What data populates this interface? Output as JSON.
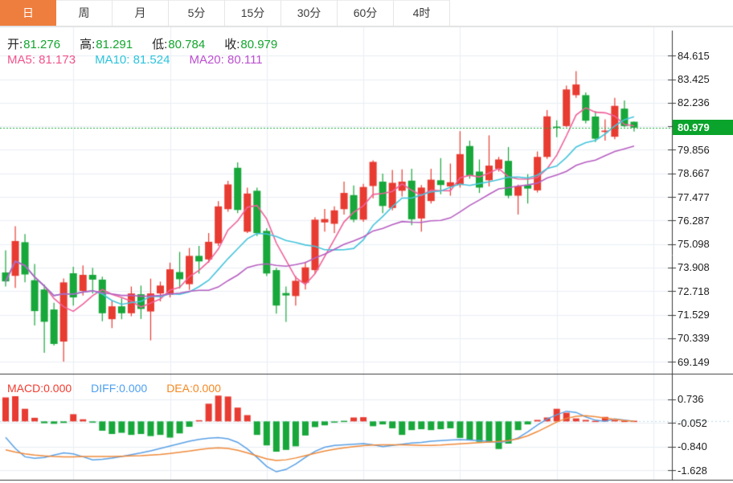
{
  "tabbar": {
    "tabs": [
      {
        "label": "日",
        "name": "tab-day",
        "active": true
      },
      {
        "label": "周",
        "name": "tab-week",
        "active": false
      },
      {
        "label": "月",
        "name": "tab-month",
        "active": false
      },
      {
        "label": "5分",
        "name": "tab-5min",
        "active": false
      },
      {
        "label": "15分",
        "name": "tab-15min",
        "active": false
      },
      {
        "label": "30分",
        "name": "tab-30min",
        "active": false
      },
      {
        "label": "60分",
        "name": "tab-60min",
        "active": false
      },
      {
        "label": "4时",
        "name": "tab-4hour",
        "active": false
      }
    ]
  },
  "legend": {
    "ohlc": [
      {
        "label": "开:",
        "value": "81.276"
      },
      {
        "label": "高:",
        "value": "81.291"
      },
      {
        "label": "低:",
        "value": "80.784"
      },
      {
        "label": "收:",
        "value": "80.979"
      }
    ],
    "ohlc_label_color": "#222222",
    "ohlc_value_color": "#13a52e",
    "ma": [
      {
        "label": "MA5: 81.173",
        "color": "#f0548c"
      },
      {
        "label": "MA10: 81.524",
        "color": "#2cc3dc"
      },
      {
        "label": "MA20: 80.111",
        "color": "#bb4fd0"
      }
    ],
    "macd": [
      {
        "label": "MACD:0.000",
        "color": "#f23b2e"
      },
      {
        "label": "DIFF:0.000",
        "color": "#4da0f0"
      },
      {
        "label": "DEA:0.000",
        "color": "#f5871f"
      }
    ]
  },
  "price_axis": {
    "ticks": [
      "84.615",
      "83.425",
      "82.236",
      "79.856",
      "78.667",
      "77.477",
      "76.287",
      "75.098",
      "73.908",
      "72.718",
      "71.529",
      "70.339",
      "69.149"
    ],
    "current_price": "80.979"
  },
  "macd_axis": {
    "ticks": [
      "0.736",
      "-0.052",
      "-0.840",
      "-1.628"
    ]
  },
  "chart_data": {
    "type": "candlestick",
    "convention": "chinese: red = up candle, green = down candle",
    "interval": "daily",
    "ylim": [
      69.149,
      84.615
    ],
    "price_tick_step": 1.18975,
    "current_price": 80.979,
    "ma_periods": [
      5,
      10,
      20
    ],
    "candles_ohlc": [
      [
        73.66,
        74.78,
        72.95,
        73.21
      ],
      [
        73.49,
        76.0,
        72.88,
        75.25
      ],
      [
        75.19,
        75.6,
        73.16,
        73.56
      ],
      [
        73.27,
        74.09,
        70.98,
        71.71
      ],
      [
        72.8,
        73.05,
        69.6,
        71.17
      ],
      [
        71.79,
        72.13,
        69.97,
        70.05
      ],
      [
        70.17,
        73.36,
        69.15,
        73.16
      ],
      [
        73.62,
        73.95,
        71.99,
        72.4
      ],
      [
        72.73,
        74.02,
        72.5,
        73.54
      ],
      [
        73.54,
        73.9,
        72.6,
        73.3
      ],
      [
        73.3,
        73.45,
        71.2,
        71.6
      ],
      [
        71.3,
        72.25,
        70.85,
        71.95
      ],
      [
        71.95,
        72.35,
        71.3,
        71.6
      ],
      [
        71.6,
        72.95,
        71.45,
        72.6
      ],
      [
        72.56,
        73.0,
        71.31,
        71.82
      ],
      [
        71.69,
        73.35,
        70.23,
        72.6
      ],
      [
        72.6,
        73.2,
        72.2,
        73.0
      ],
      [
        72.53,
        74.16,
        72.4,
        73.82
      ],
      [
        73.68,
        74.7,
        72.85,
        73.32
      ],
      [
        73.07,
        74.9,
        72.78,
        74.5
      ],
      [
        74.5,
        75.0,
        73.6,
        74.22
      ],
      [
        74.32,
        75.65,
        74.15,
        75.21
      ],
      [
        75.13,
        77.27,
        75.0,
        77.0
      ],
      [
        76.86,
        78.29,
        76.73,
        78.11
      ],
      [
        78.95,
        79.23,
        76.66,
        76.82
      ],
      [
        75.72,
        77.95,
        75.65,
        77.65
      ],
      [
        77.79,
        77.95,
        75.5,
        75.65
      ],
      [
        75.76,
        75.9,
        73.48,
        73.61
      ],
      [
        73.78,
        73.9,
        71.58,
        71.99
      ],
      [
        72.62,
        72.95,
        71.17,
        72.5
      ],
      [
        72.47,
        73.49,
        71.99,
        73.24
      ],
      [
        73.14,
        74.2,
        72.8,
        73.92
      ],
      [
        73.78,
        76.45,
        73.6,
        76.33
      ],
      [
        76.19,
        76.87,
        75.72,
        76.36
      ],
      [
        76.12,
        77.0,
        75.65,
        76.8
      ],
      [
        76.86,
        78.25,
        76.59,
        77.68
      ],
      [
        77.57,
        78.06,
        76.2,
        76.33
      ],
      [
        76.33,
        78.14,
        76.22,
        77.98
      ],
      [
        78.03,
        79.33,
        77.41,
        79.25
      ],
      [
        78.25,
        78.66,
        76.66,
        77.02
      ],
      [
        76.92,
        78.84,
        76.8,
        78.19
      ],
      [
        77.79,
        78.87,
        77.5,
        78.25
      ],
      [
        78.3,
        78.9,
        76.05,
        76.35
      ],
      [
        76.39,
        78.08,
        75.72,
        77.95
      ],
      [
        77.27,
        78.9,
        77.14,
        78.35
      ],
      [
        78.32,
        79.44,
        77.61,
        78.08
      ],
      [
        78.01,
        79.17,
        77.54,
        78.22
      ],
      [
        78.08,
        80.8,
        77.95,
        79.64
      ],
      [
        80.05,
        80.32,
        78.4,
        78.56
      ],
      [
        78.76,
        79.37,
        77.68,
        77.95
      ],
      [
        78.32,
        80.59,
        78.01,
        79.06
      ],
      [
        78.9,
        79.5,
        78.76,
        79.37
      ],
      [
        79.3,
        80.0,
        77.41,
        77.54
      ],
      [
        77.54,
        78.1,
        76.59,
        78.01
      ],
      [
        78.08,
        78.63,
        77.14,
        77.9
      ],
      [
        77.81,
        79.77,
        77.7,
        79.5
      ],
      [
        79.5,
        81.87,
        79.4,
        81.55
      ],
      [
        81.03,
        81.35,
        80.5,
        80.97
      ],
      [
        81.06,
        83.1,
        81.0,
        82.91
      ],
      [
        82.62,
        83.84,
        82.49,
        83.16
      ],
      [
        82.62,
        82.76,
        81.2,
        81.33
      ],
      [
        81.54,
        81.81,
        80.25,
        80.42
      ],
      [
        80.76,
        81.4,
        80.32,
        80.83
      ],
      [
        80.52,
        82.49,
        80.39,
        82.08
      ],
      [
        81.94,
        82.35,
        81.0,
        81.06
      ],
      [
        81.276,
        81.291,
        80.784,
        80.979
      ]
    ],
    "macd": {
      "ylim": [
        -1.628,
        0.736
      ],
      "hist": [
        0.8,
        0.84,
        0.42,
        0.12,
        -0.06,
        -0.08,
        -0.05,
        0.24,
        0.07,
        -0.04,
        -0.31,
        -0.42,
        -0.38,
        -0.45,
        -0.42,
        -0.49,
        -0.45,
        -0.54,
        -0.4,
        -0.18,
        0.04,
        0.59,
        0.86,
        0.83,
        0.46,
        0.21,
        -0.45,
        -0.8,
        -1.01,
        -0.95,
        -0.83,
        -0.47,
        -0.19,
        -0.13,
        -0.04,
        -0.03,
        0.13,
        0.14,
        -0.16,
        -0.1,
        -0.23,
        -0.45,
        -0.29,
        -0.26,
        -0.29,
        -0.26,
        -0.23,
        -0.55,
        -0.62,
        -0.68,
        -0.7,
        -0.92,
        -0.74,
        -0.29,
        -0.1,
        0.05,
        0.13,
        0.42,
        0.29,
        0.1,
        0.05,
        0.02,
        0.15,
        0.05,
        0.01,
        0.0
      ],
      "diff": [
        -0.53,
        -0.9,
        -1.18,
        -1.23,
        -1.2,
        -1.12,
        -1.05,
        -1.08,
        -1.18,
        -1.28,
        -1.26,
        -1.22,
        -1.17,
        -1.11,
        -1.05,
        -0.98,
        -0.9,
        -0.82,
        -0.74,
        -0.66,
        -0.6,
        -0.56,
        -0.54,
        -0.58,
        -0.7,
        -0.92,
        -1.2,
        -1.5,
        -1.68,
        -1.6,
        -1.42,
        -1.2,
        -1.0,
        -0.86,
        -0.8,
        -0.78,
        -0.76,
        -0.74,
        -0.78,
        -0.84,
        -0.8,
        -0.76,
        -0.72,
        -0.7,
        -0.66,
        -0.64,
        -0.62,
        -0.61,
        -0.62,
        -0.64,
        -0.67,
        -0.7,
        -0.66,
        -0.55,
        -0.35,
        -0.12,
        0.08,
        0.22,
        0.34,
        0.3,
        0.15,
        0.04,
        0.0,
        0.08,
        0.04,
        0.0
      ],
      "dea": [
        -0.95,
        -1.02,
        -1.08,
        -1.12,
        -1.15,
        -1.17,
        -1.18,
        -1.18,
        -1.17,
        -1.17,
        -1.17,
        -1.17,
        -1.16,
        -1.15,
        -1.14,
        -1.12,
        -1.1,
        -1.07,
        -1.03,
        -0.99,
        -0.94,
        -0.9,
        -0.88,
        -0.9,
        -0.96,
        -1.05,
        -1.15,
        -1.25,
        -1.3,
        -1.28,
        -1.22,
        -1.14,
        -1.06,
        -0.99,
        -0.93,
        -0.88,
        -0.84,
        -0.81,
        -0.79,
        -0.78,
        -0.78,
        -0.78,
        -0.79,
        -0.8,
        -0.8,
        -0.79,
        -0.77,
        -0.75,
        -0.73,
        -0.71,
        -0.69,
        -0.67,
        -0.64,
        -0.58,
        -0.48,
        -0.34,
        -0.18,
        -0.02,
        0.1,
        0.17,
        0.19,
        0.16,
        0.11,
        0.07,
        0.03,
        0.0
      ]
    },
    "colors": {
      "up": "#e83b31",
      "down": "#17a73a",
      "ma5": "#f0619a",
      "ma10": "#45c5dd",
      "ma20": "#b75fc2",
      "diff_line": "#5aa0e6",
      "dea_line": "#f08a3a",
      "grid": "#e9eef4",
      "frame": "#3c3c3c",
      "plot_top_border": "#dfe3e8",
      "current_price_line": "#1fae3c",
      "macd_zero_dash": "#b8dcec",
      "price_tag_bg": "#0aa32b",
      "tab_active_bg": "#ee7e3e"
    }
  }
}
